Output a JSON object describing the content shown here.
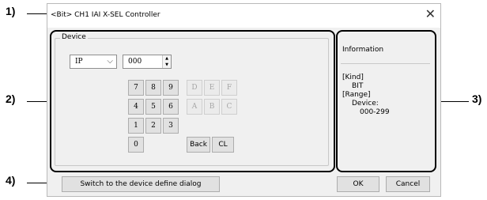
{
  "callouts": [
    "1)",
    "2)",
    "3)",
    "4)"
  ],
  "dialog": {
    "title": "<Bit> CH1 IAI X-SEL Controller",
    "close_icon": "close-icon"
  },
  "device": {
    "group_label": "Device",
    "type_value": "IP",
    "address_value": "000",
    "keys": [
      "7",
      "8",
      "9",
      "D",
      "E",
      "F",
      "4",
      "5",
      "6",
      "A",
      "B",
      "C",
      "1",
      "2",
      "3",
      "0"
    ],
    "back_label": "Back",
    "clear_label": "CL"
  },
  "information": {
    "title": "Information",
    "kind_label": "[Kind]",
    "kind_value": "BIT",
    "range_label": "[Range]",
    "range_device_label": "Device:",
    "range_value": "000-299"
  },
  "footer": {
    "switch_label": "Switch to the device define dialog",
    "ok_label": "OK",
    "cancel_label": "Cancel"
  }
}
